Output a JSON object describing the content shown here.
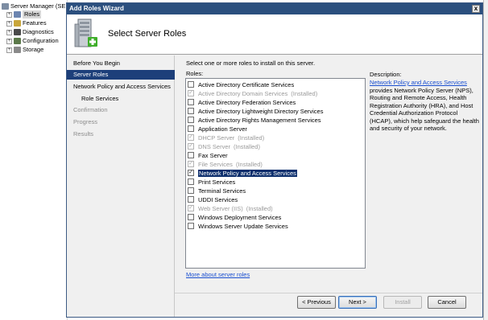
{
  "tree": {
    "items": [
      {
        "label": "Server Manager (SE",
        "expander": ""
      },
      {
        "label": "Roles",
        "expander": "+"
      },
      {
        "label": "Features",
        "expander": "+"
      },
      {
        "label": "Diagnostics",
        "expander": "+"
      },
      {
        "label": "Configuration",
        "expander": "+"
      },
      {
        "label": "Storage",
        "expander": "+"
      }
    ]
  },
  "dialog": {
    "title": "Add Roles Wizard",
    "close_glyph": "x",
    "heading": "Select Server Roles"
  },
  "nav": {
    "items": [
      {
        "label": "Before You Begin",
        "state": "normal"
      },
      {
        "label": "Server Roles",
        "state": "active"
      },
      {
        "label": "Network Policy and Access Services",
        "state": "normal"
      },
      {
        "label": "Role Services",
        "state": "sub"
      },
      {
        "label": "Confirmation",
        "state": "disabled"
      },
      {
        "label": "Progress",
        "state": "disabled"
      },
      {
        "label": "Results",
        "state": "disabled"
      }
    ]
  },
  "content": {
    "instructions": "Select one or more roles to install on this server.",
    "roles_label": "Roles:",
    "roles": [
      {
        "label": "Active Directory Certificate Services",
        "status": "",
        "checked": false,
        "installed": false
      },
      {
        "label": "Active Directory Domain Services",
        "status": "(Installed)",
        "checked": true,
        "installed": true
      },
      {
        "label": "Active Directory Federation Services",
        "status": "",
        "checked": false,
        "installed": false
      },
      {
        "label": "Active Directory Lightweight Directory Services",
        "status": "",
        "checked": false,
        "installed": false
      },
      {
        "label": "Active Directory Rights Management Services",
        "status": "",
        "checked": false,
        "installed": false
      },
      {
        "label": "Application Server",
        "status": "",
        "checked": false,
        "installed": false
      },
      {
        "label": "DHCP Server",
        "status": "(Installed)",
        "checked": true,
        "installed": true
      },
      {
        "label": "DNS Server",
        "status": "(Installed)",
        "checked": true,
        "installed": true
      },
      {
        "label": "Fax Server",
        "status": "",
        "checked": false,
        "installed": false
      },
      {
        "label": "File Services",
        "status": "(Installed)",
        "checked": true,
        "installed": true
      },
      {
        "label": "Network Policy and Access Services",
        "status": "",
        "checked": true,
        "installed": false,
        "selected": true
      },
      {
        "label": "Print Services",
        "status": "",
        "checked": false,
        "installed": false
      },
      {
        "label": "Terminal Services",
        "status": "",
        "checked": false,
        "installed": false
      },
      {
        "label": "UDDI Services",
        "status": "",
        "checked": false,
        "installed": false
      },
      {
        "label": "Web Server (IIS)",
        "status": "(Installed)",
        "checked": true,
        "installed": true
      },
      {
        "label": "Windows Deployment Services",
        "status": "",
        "checked": false,
        "installed": false
      },
      {
        "label": "Windows Server Update Services",
        "status": "",
        "checked": false,
        "installed": false
      }
    ],
    "description_label": "Description:",
    "description_link": "Network Policy and Access Services",
    "description_body": " provides Network Policy Server (NPS), Routing and Remote Access, Health Registration Authority (HRA), and Host Credential Authorization Protocol (HCAP), which help safeguard the health and security of your network.",
    "more_link": "More about server roles",
    "check_glyph": "✓"
  },
  "buttons": {
    "previous": "< Previous",
    "next": "Next >",
    "install": "Install",
    "cancel": "Cancel"
  },
  "colors": {
    "titlebar": "#2b4f7e",
    "nav_active": "#1d3f7a",
    "link": "#1a4fd0",
    "selection": "#0d2f6d"
  }
}
